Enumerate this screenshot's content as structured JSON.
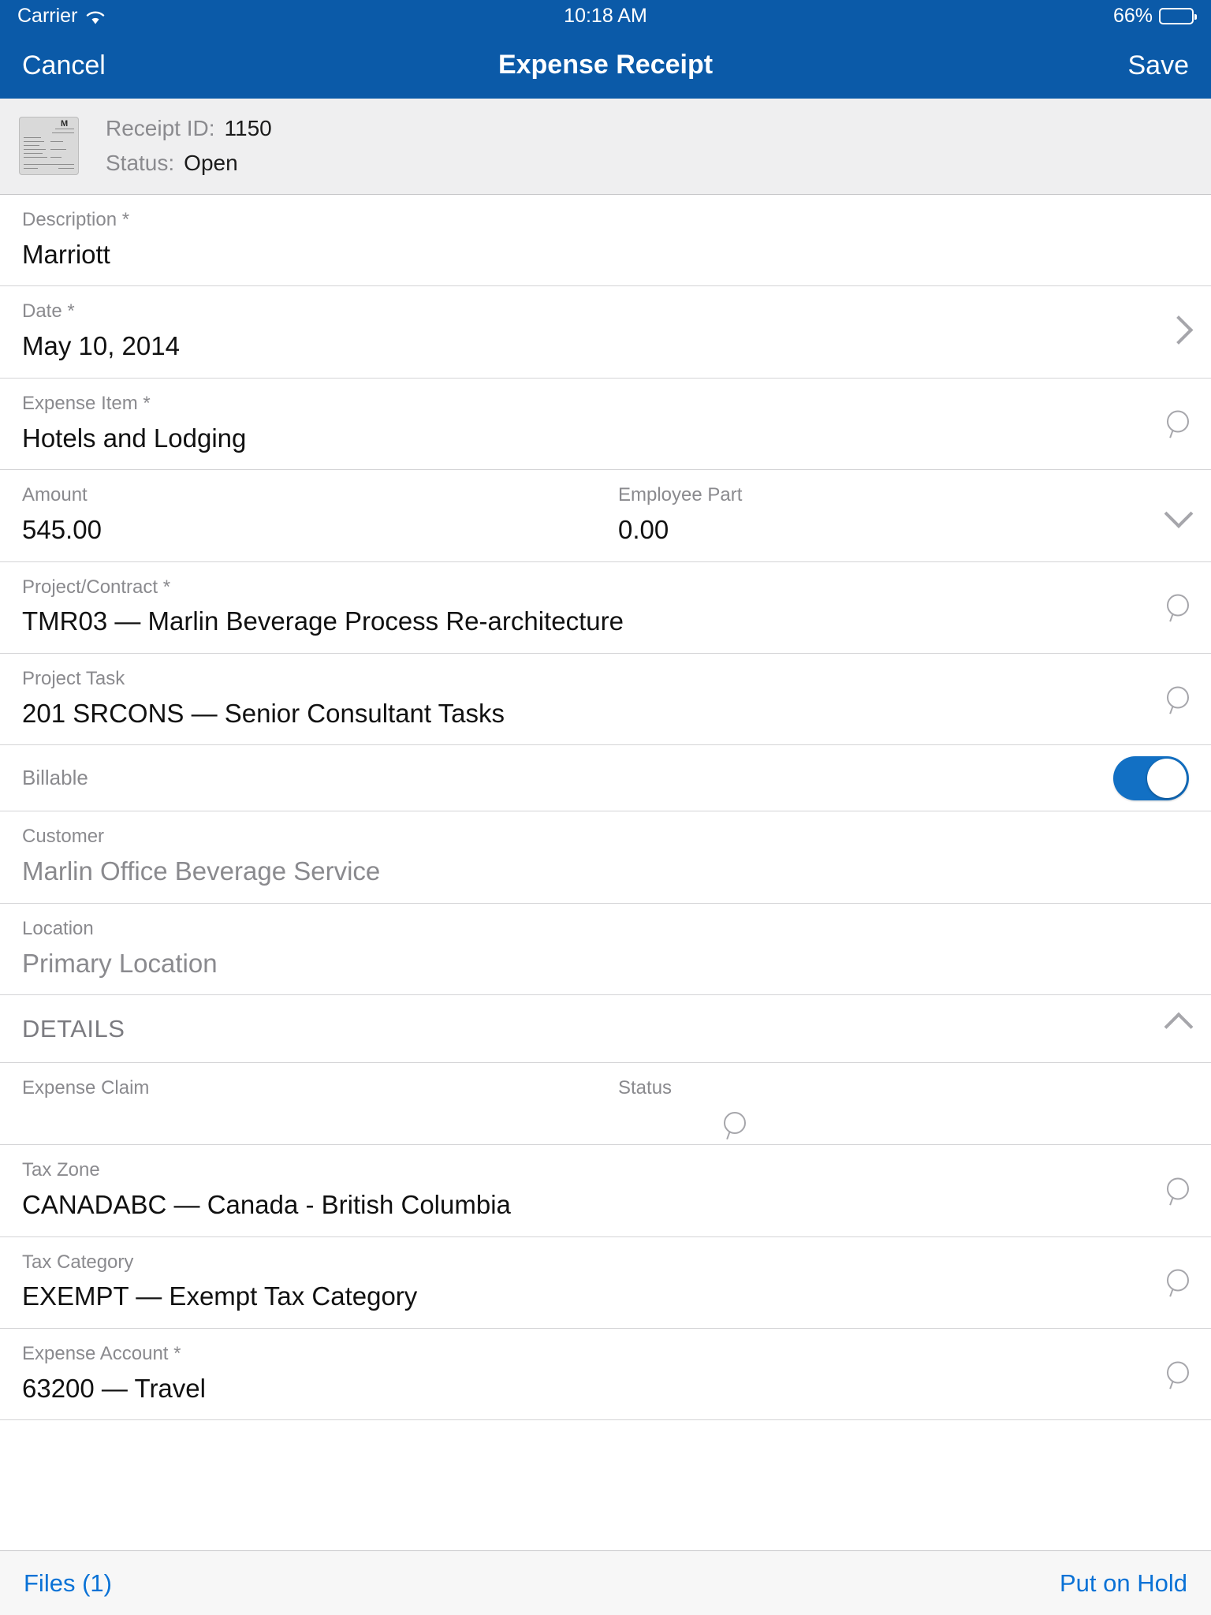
{
  "status_bar": {
    "carrier": "Carrier",
    "wifi_icon": "wifi-icon",
    "time": "10:18 AM",
    "battery_percent": "66%",
    "battery_level": 66
  },
  "nav_bar": {
    "cancel_label": "Cancel",
    "title": "Expense Receipt",
    "save_label": "Save"
  },
  "header_panel": {
    "thumbnail_icon": "receipt-thumbnail",
    "receipt_id_label": "Receipt ID:",
    "receipt_id_value": "1150",
    "status_label": "Status:",
    "status_value": "Open"
  },
  "form": {
    "description": {
      "label": "Description *",
      "value": "Marriott"
    },
    "date": {
      "label": "Date *",
      "value": "May 10, 2014",
      "accessory": "chevron-right-icon"
    },
    "expense_item": {
      "label": "Expense Item *",
      "value": "Hotels and Lodging",
      "accessory": "lookup-icon"
    },
    "amount": {
      "label": "Amount",
      "value": "545.00"
    },
    "employee_part": {
      "label": "Employee Part",
      "value": "0.00",
      "accessory": "chevron-down-icon"
    },
    "project_contract": {
      "label": "Project/Contract *",
      "value": "TMR03 — Marlin Beverage Process Re-architecture",
      "accessory": "lookup-icon"
    },
    "project_task": {
      "label": "Project Task",
      "value": "201 SRCONS — Senior Consultant Tasks",
      "accessory": "lookup-icon"
    },
    "billable": {
      "label": "Billable",
      "on": true
    },
    "customer": {
      "label": "Customer",
      "value": "Marlin Office Beverage Service",
      "readonly": true
    },
    "location": {
      "label": "Location",
      "value": "Primary Location",
      "readonly": true
    }
  },
  "details_section": {
    "title": "DETAILS",
    "collapse_icon": "chevron-up-icon",
    "expense_claim": {
      "label": "Expense Claim",
      "value": ""
    },
    "status": {
      "label": "Status",
      "value": "",
      "accessory": "lookup-icon"
    },
    "tax_zone": {
      "label": "Tax Zone",
      "value": "CANADABC — Canada - British Columbia",
      "accessory": "lookup-icon"
    },
    "tax_category": {
      "label": "Tax Category",
      "value": "EXEMPT — Exempt Tax Category",
      "accessory": "lookup-icon"
    },
    "expense_account": {
      "label": "Expense Account *",
      "value": "63200 — Travel",
      "accessory": "lookup-icon"
    }
  },
  "toolbar": {
    "files_label": "Files (1)",
    "put_on_hold_label": "Put on Hold"
  },
  "colors": {
    "nav_blue": "#0b5aa8",
    "link_blue": "#0a72d6",
    "toggle_on": "#1270c4",
    "panel_gray": "#efeff0",
    "label_gray": "#8a8a8e",
    "value_black": "#111111"
  }
}
